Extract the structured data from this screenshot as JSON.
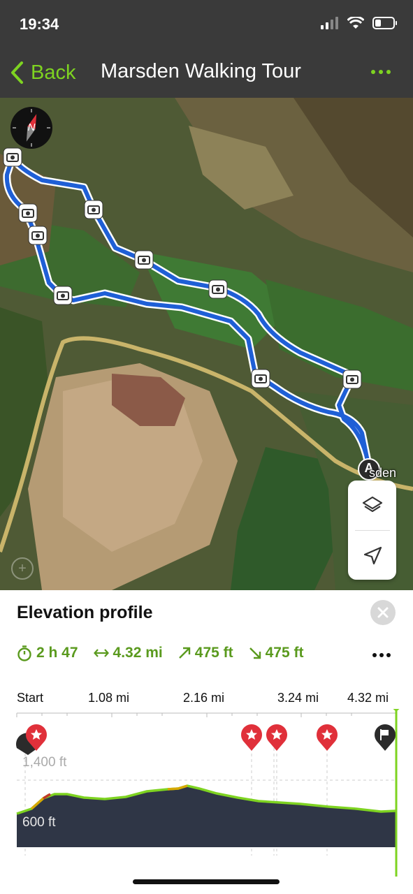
{
  "status_bar": {
    "time": "19:34"
  },
  "nav": {
    "back_label": "Back",
    "title": "Marsden Walking Tour"
  },
  "map": {
    "compass_letter": "N",
    "town_label": "sden",
    "start_marker": "A"
  },
  "sheet": {
    "title": "Elevation profile",
    "stats": {
      "duration": "2 h 47",
      "distance": "4.32 mi",
      "ascent": "475 ft",
      "descent": "475 ft"
    },
    "axis": [
      "Start",
      "1.08 mi",
      "2.16 mi",
      "3.24 mi",
      "4.32 mi"
    ],
    "elevation_labels": {
      "high": "1,400 ft",
      "low": "600 ft"
    }
  },
  "colors": {
    "accent_green": "#7ed321",
    "stat_green": "#5a9a1e",
    "route_blue": "#1f5fd6",
    "profile_fill": "#2f3646",
    "poi_red": "#e0303a"
  }
}
